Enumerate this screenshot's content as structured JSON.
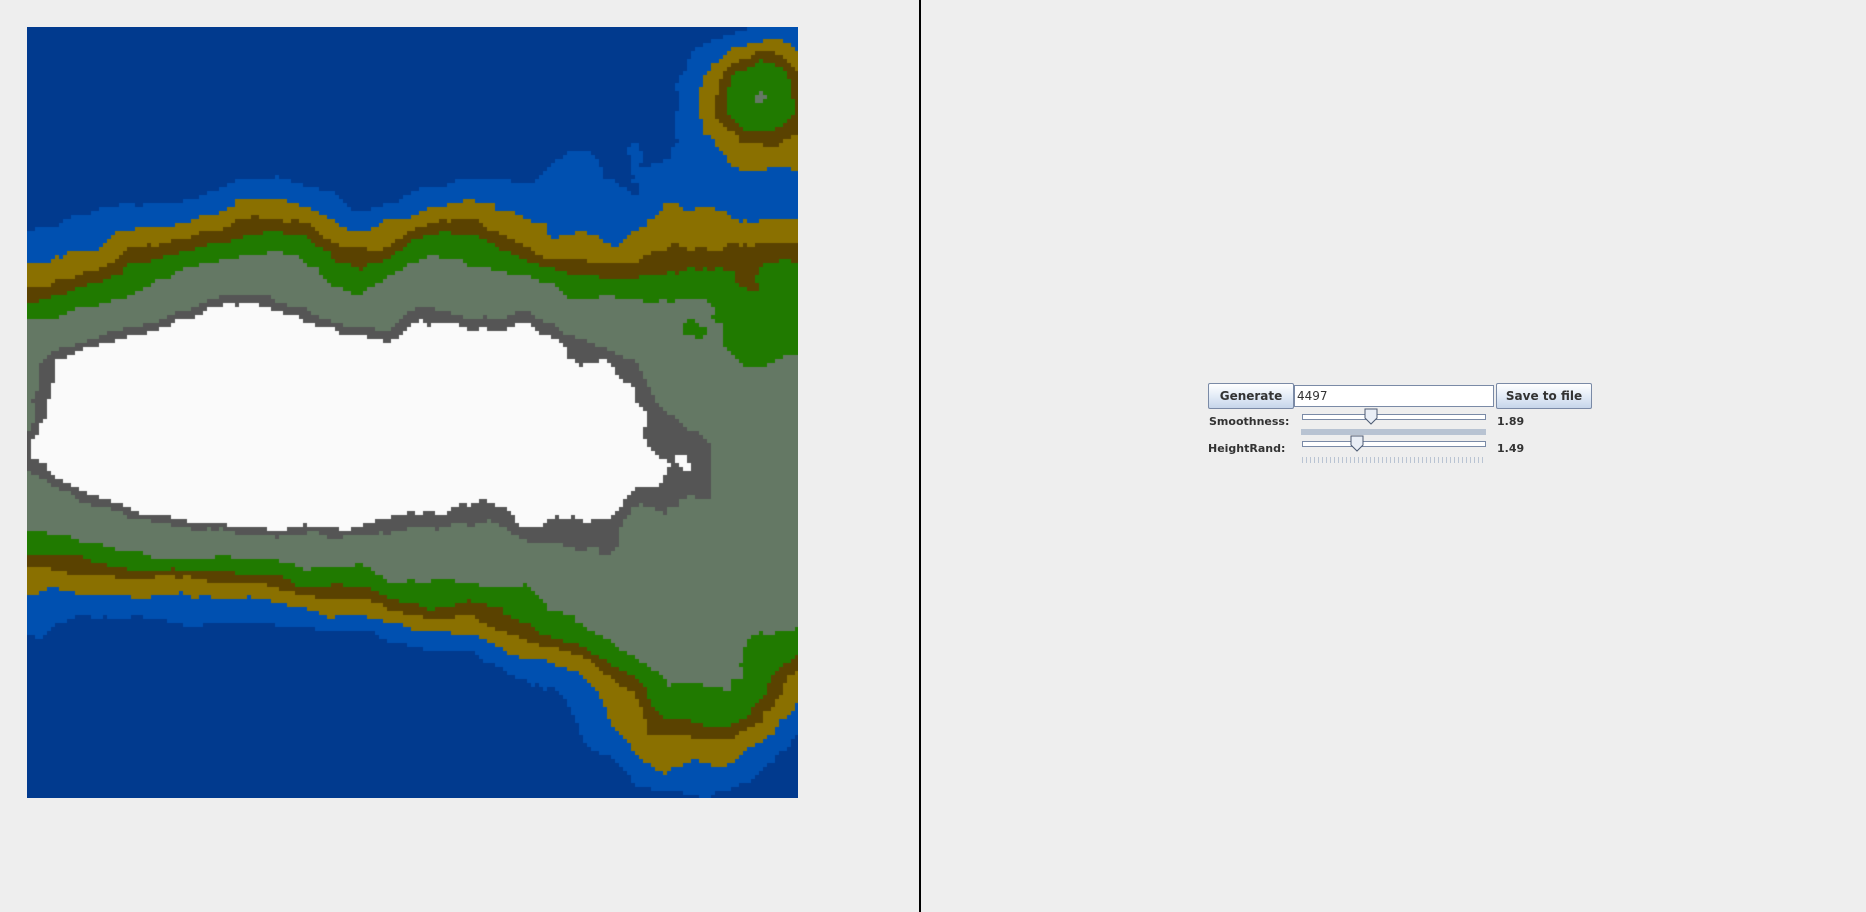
{
  "controls": {
    "generate_label": "Generate",
    "seed_value": "4497",
    "save_label": "Save to file",
    "smoothness": {
      "label": "Smoothness:",
      "value": 1.89,
      "value_text": "1.89",
      "fraction": 0.38
    },
    "height_rand": {
      "label": "HeightRand:",
      "value": 1.49,
      "value_text": "1.49",
      "fraction": 0.3
    }
  },
  "terrain": {
    "palette": {
      "deep_water": "#013A8E",
      "shallow_water": "#0050B0",
      "sand": "#8A7000",
      "hills": "#5A4200",
      "grass": "#207A00",
      "plains": "#647864",
      "rock": "#555555",
      "snow": "#FAFAFA"
    }
  }
}
